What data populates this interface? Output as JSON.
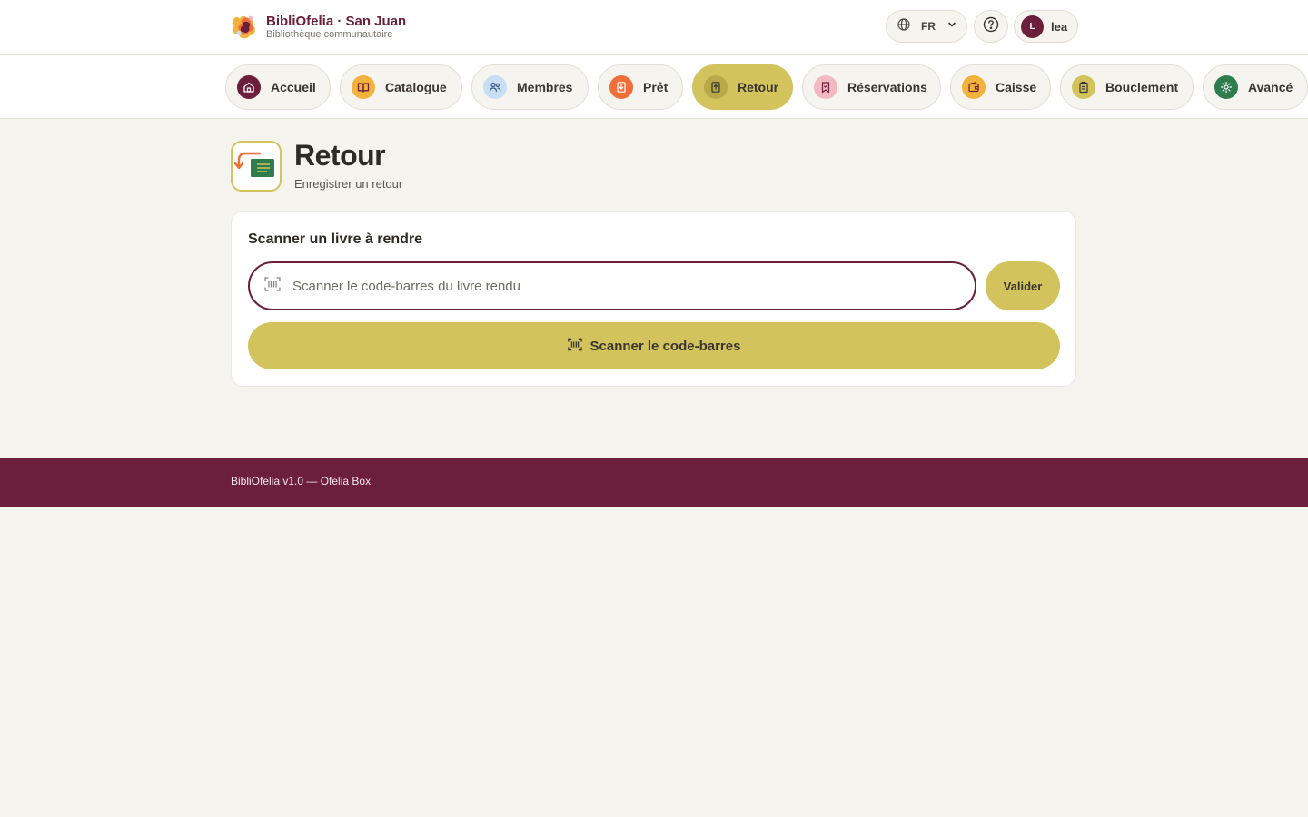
{
  "brand": {
    "title": "BibliOfelia · San Juan",
    "subtitle": "Bibliothèque communautaire"
  },
  "header": {
    "language": "FR",
    "user_initial": "L",
    "user_name": "lea"
  },
  "nav": {
    "items": [
      {
        "label": "Accueil",
        "icon": "home-icon",
        "color": "#6b1f3a"
      },
      {
        "label": "Catalogue",
        "icon": "book-open-icon",
        "color": "#f2b33d"
      },
      {
        "label": "Membres",
        "icon": "users-icon",
        "color": "#c9def5"
      },
      {
        "label": "Prêt",
        "icon": "loan-book-icon",
        "color": "#ee6f3a"
      },
      {
        "label": "Retour",
        "icon": "return-book-icon",
        "color": "#b8a94a",
        "active": true
      },
      {
        "label": "Réservations",
        "icon": "bookmark-icon",
        "color": "#f3b9c2"
      },
      {
        "label": "Caisse",
        "icon": "wallet-icon",
        "color": "#f2b33d"
      },
      {
        "label": "Bouclement",
        "icon": "clipboard-icon",
        "color": "#d2c35c"
      },
      {
        "label": "Avancé",
        "icon": "gear-icon",
        "color": "#2f7d4f"
      }
    ]
  },
  "page": {
    "title": "Retour",
    "subtitle": "Enregistrer un retour"
  },
  "card": {
    "title": "Scanner un livre à rendre",
    "input_placeholder": "Scanner le code-barres du livre rendu",
    "input_value": "",
    "validate_label": "Valider",
    "scan_label": "Scanner le code-barres"
  },
  "footer": {
    "text": "BibliOfelia v1.0 — Ofelia Box"
  },
  "colors": {
    "brand": "#6b1f3a",
    "accent": "#d2c35c",
    "background": "#f4f3ee"
  }
}
